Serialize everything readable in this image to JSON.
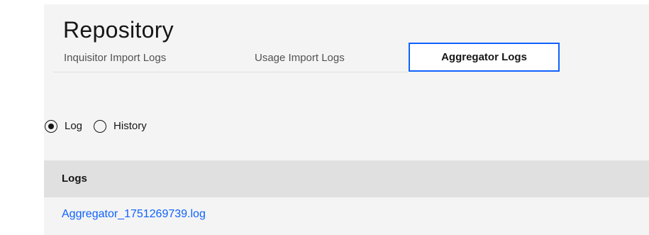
{
  "page": {
    "title": "Repository"
  },
  "tabs": [
    {
      "label": "Inquisitor Import Logs",
      "active": false
    },
    {
      "label": "Usage Import Logs",
      "active": false
    },
    {
      "label": "Aggregator Logs",
      "active": true
    }
  ],
  "view_toggle": {
    "options": [
      {
        "label": "Log",
        "selected": true
      },
      {
        "label": "History",
        "selected": false
      }
    ]
  },
  "table": {
    "header": "Logs",
    "rows": [
      {
        "file": "Aggregator_1751269739.log"
      }
    ]
  },
  "colors": {
    "accent": "#0f62fe",
    "panel_bg": "#f4f4f4",
    "table_header_bg": "#e0e0e0",
    "text": "#161616",
    "muted_text": "#525252"
  }
}
